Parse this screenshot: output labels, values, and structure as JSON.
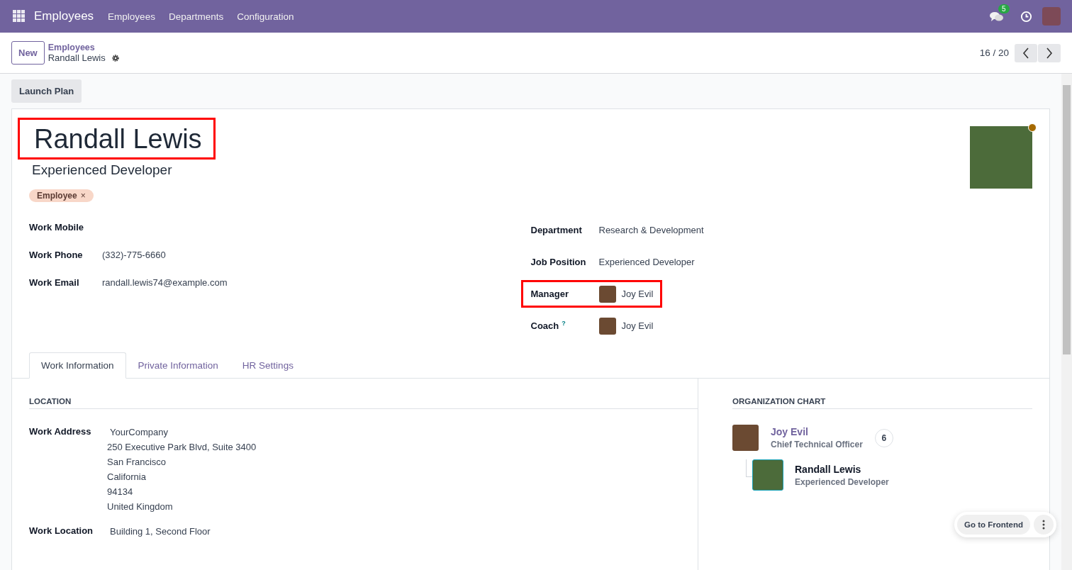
{
  "navbar": {
    "app_name": "Employees",
    "menu": [
      "Employees",
      "Departments",
      "Configuration"
    ],
    "messages_badge": "5"
  },
  "control_panel": {
    "new_button": "New",
    "breadcrumb_parent": "Employees",
    "breadcrumb_current": "Randall Lewis",
    "pager": "16 / 20"
  },
  "action_buttons": [
    "Launch Plan"
  ],
  "employee": {
    "name": "Randall Lewis",
    "name_highlighted": true,
    "job_title": "Experienced Developer",
    "tags": [
      {
        "label": "Employee",
        "remove_symbol": "×",
        "color": "#f8d7c8"
      }
    ],
    "left_fields": [
      {
        "label": "Work Mobile"
      },
      {
        "label": "Work Phone",
        "value": "(332)-775-6660"
      },
      {
        "label": "Work Email",
        "value": "randall.lewis74@example.com"
      }
    ],
    "right_fields": [
      {
        "label": "Department",
        "value": "Research & Development",
        "avatar": false,
        "highlighted": false
      },
      {
        "label": "Job Position",
        "value": "Experienced Developer",
        "avatar": false,
        "highlighted": false
      },
      {
        "label": "Manager",
        "value": "Joy Evil",
        "avatar": true,
        "highlighted": true
      },
      {
        "label": "Coach",
        "help": "?",
        "value": "Joy Evil",
        "avatar": true,
        "highlighted": false
      }
    ]
  },
  "tabs": [
    {
      "label": "Work Information",
      "selected": true
    },
    {
      "label": "Private Information",
      "selected": false
    },
    {
      "label": "HR Settings",
      "selected": false
    }
  ],
  "location": {
    "title": "LOCATION",
    "work_address_label": "Work Address",
    "work_address": [
      "YourCompany",
      "250 Executive Park Blvd, Suite 3400",
      "San Francisco",
      "California",
      "94134",
      "United Kingdom"
    ],
    "work_location_label": "Work Location",
    "work_location": "Building 1, Second Floor"
  },
  "organization_chart": {
    "title": "ORGANIZATION CHART",
    "manager": {
      "name": "Joy Evil",
      "title": "Chief Technical Officer",
      "count": "6"
    },
    "employee": {
      "name": "Randall Lewis",
      "title": "Experienced Developer"
    }
  },
  "floating_button": "Go to Frontend"
}
